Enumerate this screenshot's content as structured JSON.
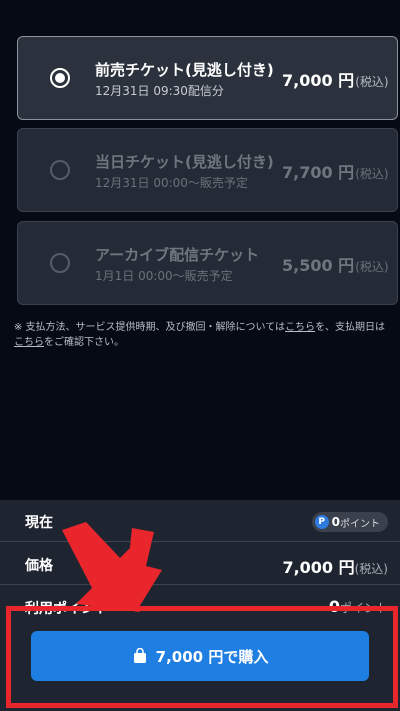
{
  "tickets": [
    {
      "name": "前売チケット(見逃し付き)",
      "sub": "12月31日 09:30配信分",
      "price": "7,000 円",
      "tax": "(税込)",
      "selected": true
    },
    {
      "name": "当日チケット(見逃し付き)",
      "sub": "12月31日 00:00〜販売予定",
      "price": "7,700 円",
      "tax": "(税込)",
      "selected": false
    },
    {
      "name": "アーカイブ配信チケット",
      "sub": "1月1日 00:00〜販売予定",
      "price": "5,500 円",
      "tax": "(税込)",
      "selected": false
    }
  ],
  "note": {
    "line1_a": "※ 支払方法、サービス提供時期、及び撤回・解除については",
    "link1": "こちら",
    "line1_b": "を、支払期日は",
    "link2": "こちら",
    "line2_b": "をご確認下さい。"
  },
  "summary": {
    "current_label": "現在",
    "current_points_badge": "P",
    "current_points": "0",
    "points_unit": "ポイント",
    "price_label": "価格",
    "price_value": "7,000 円",
    "price_tax": "(税込)",
    "use_points_label": "利用ポイント",
    "use_points_value": "0",
    "use_points_unit": "ポイント"
  },
  "buy_button": {
    "label": "7,000 円で購入",
    "icon": "shopping-bag-icon"
  },
  "colors": {
    "background": "#050a14",
    "accent": "#1f7ee1",
    "highlight": "#e8262b"
  }
}
